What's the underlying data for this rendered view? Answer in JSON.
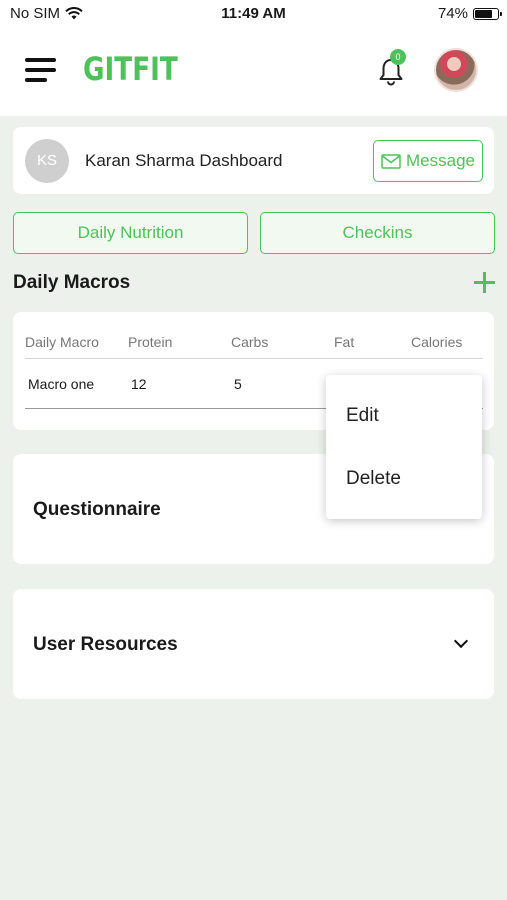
{
  "status_bar": {
    "carrier": "No SIM",
    "time": "11:49 AM",
    "battery": "74%"
  },
  "header": {
    "logo": "GITFIT",
    "notification_count": "0",
    "colors": {
      "accent": "#4fc15a"
    }
  },
  "profile": {
    "initials": "KS",
    "name": "Karan Sharma Dashboard",
    "message_label": "Message"
  },
  "tabs": [
    {
      "label": "Daily Nutrition"
    },
    {
      "label": "Checkins"
    }
  ],
  "daily_macros": {
    "title": "Daily Macros",
    "columns": [
      "Daily Macro",
      "Protein",
      "Carbs",
      "Fat",
      "Calories"
    ],
    "rows": [
      {
        "name": "Macro one",
        "protein": "12",
        "carbs": "5"
      }
    ]
  },
  "context_menu": {
    "items": [
      "Edit",
      "Delete"
    ]
  },
  "sections": {
    "questionnaire": "Questionnaire",
    "user_resources": "User Resources"
  },
  "icons": [
    "menu-icon",
    "bell-icon",
    "avatar",
    "mail-icon",
    "plus-icon",
    "chevron-down-icon",
    "wifi-icon",
    "battery-icon"
  ]
}
